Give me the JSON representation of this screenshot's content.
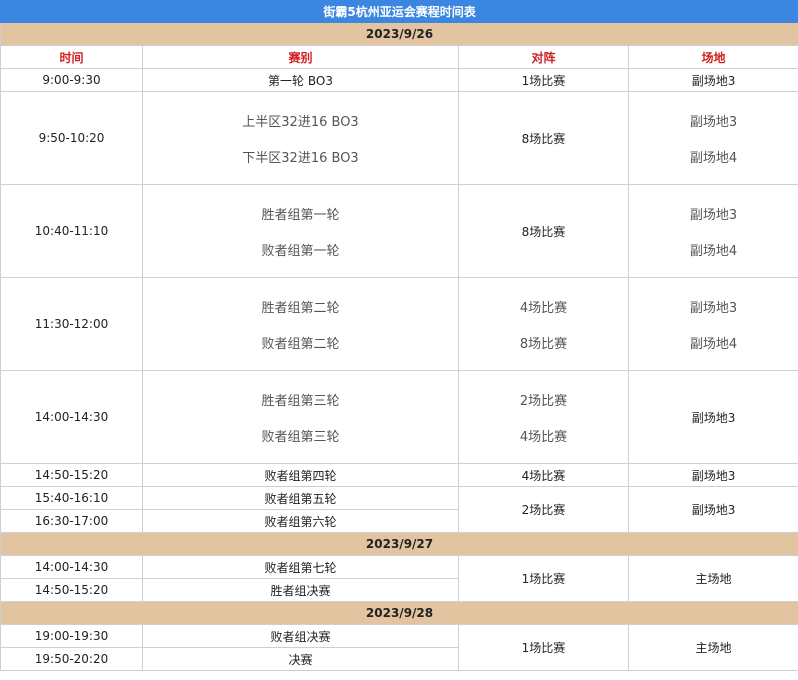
{
  "title": "街霸5杭州亚运会赛程时间表",
  "headers": [
    "时间",
    "赛别",
    "对阵",
    "场地"
  ],
  "days": [
    {
      "date": "2023/9/26",
      "rows": [
        {
          "time": "9:00-9:30",
          "event": [
            "第一轮 BO3"
          ],
          "matchup": [
            "1场比赛"
          ],
          "venue": [
            "副场地3"
          ]
        },
        {
          "time": "9:50-10:20",
          "event": [
            "上半区32进16 BO3",
            "下半区32进16 BO3"
          ],
          "matchup": [
            "8场比赛"
          ],
          "venue": [
            "副场地3",
            "副场地4"
          ]
        },
        {
          "time": "10:40-11:10",
          "event": [
            "胜者组第一轮",
            "败者组第一轮"
          ],
          "matchup": [
            "8场比赛"
          ],
          "venue": [
            "副场地3",
            "副场地4"
          ]
        },
        {
          "time": "11:30-12:00",
          "event": [
            "胜者组第二轮",
            "败者组第二轮"
          ],
          "matchup": [
            "4场比赛",
            "8场比赛"
          ],
          "venue": [
            "副场地3",
            "副场地4"
          ]
        },
        {
          "time": "14:00-14:30",
          "event": [
            "胜者组第三轮",
            "败者组第三轮"
          ],
          "matchup": [
            "2场比赛",
            "4场比赛"
          ],
          "venue": [
            "副场地3"
          ]
        },
        {
          "time": "14:50-15:20",
          "event": [
            "败者组第四轮"
          ],
          "matchup": [
            "4场比赛"
          ],
          "venue": [
            "副场地3"
          ]
        },
        {
          "time": "15:40-16:10",
          "event": [
            "败者组第五轮"
          ],
          "matchup": [
            "2场比赛"
          ],
          "venue": [
            "副场地3"
          ]
        },
        {
          "time": "16:30-17:00",
          "event": [
            "败者组第六轮"
          ]
        }
      ]
    },
    {
      "date": "2023/9/27",
      "rows": [
        {
          "time": "14:00-14:30",
          "event": [
            "败者组第七轮"
          ],
          "matchup": [
            "1场比赛"
          ],
          "venue": [
            "主场地"
          ]
        },
        {
          "time": "14:50-15:20",
          "event": [
            "胜者组决赛"
          ]
        }
      ]
    },
    {
      "date": "2023/9/28",
      "rows": [
        {
          "time": "19:00-19:30",
          "event": [
            "败者组决赛"
          ],
          "matchup": [
            "1场比赛"
          ],
          "venue": [
            "主场地"
          ]
        },
        {
          "time": "19:50-20:20",
          "event": [
            "决赛"
          ]
        }
      ]
    }
  ]
}
